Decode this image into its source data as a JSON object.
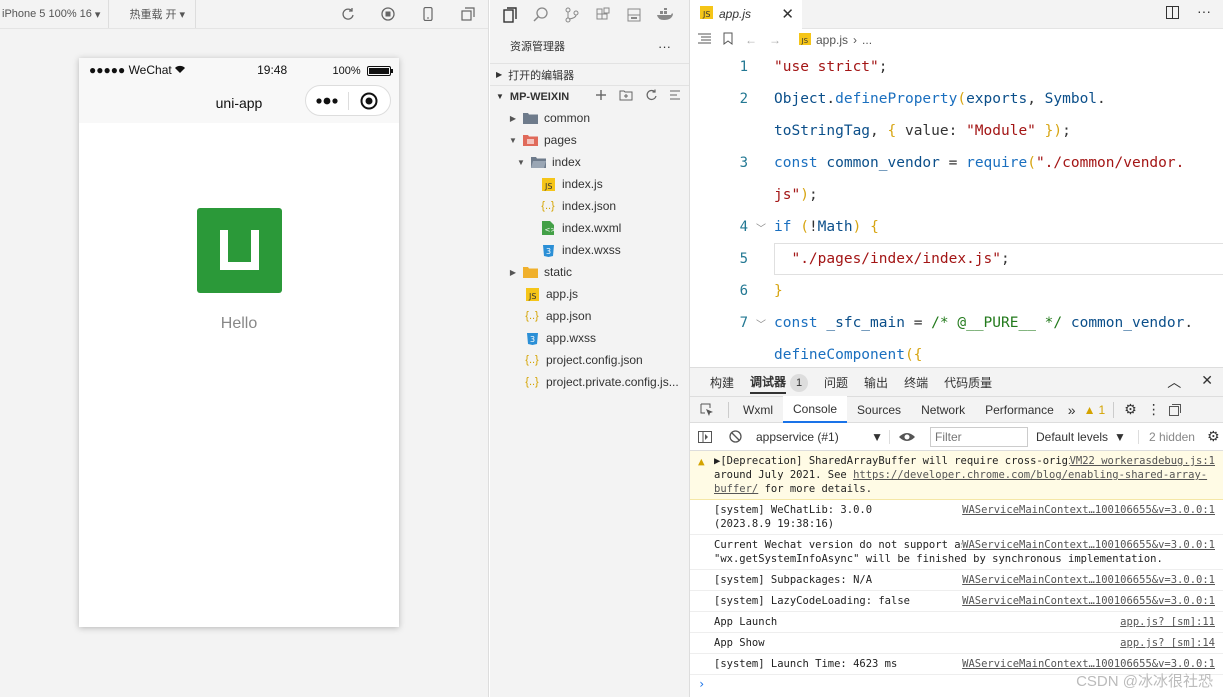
{
  "simulator": {
    "device_label": "iPhone 5 100% 16",
    "hot_reload_label": "热重载 开",
    "status": {
      "carrier": "●●●●● WeChat",
      "time": "19:48",
      "battery": "100%"
    },
    "nav_title": "uni-app",
    "hello": "Hello"
  },
  "explorer": {
    "title": "资源管理器",
    "more": "···",
    "open_editors": "打开的编辑器",
    "project": "MP-WEIXIN",
    "tree": [
      {
        "label": "common",
        "type": "folder"
      },
      {
        "label": "pages",
        "type": "folder-open"
      },
      {
        "label": "index",
        "type": "folder-open"
      },
      {
        "label": "index.js",
        "type": "js"
      },
      {
        "label": "index.json",
        "type": "json"
      },
      {
        "label": "index.wxml",
        "type": "wxml"
      },
      {
        "label": "index.wxss",
        "type": "wxss"
      },
      {
        "label": "static",
        "type": "folder"
      },
      {
        "label": "app.js",
        "type": "js"
      },
      {
        "label": "app.json",
        "type": "json"
      },
      {
        "label": "app.wxss",
        "type": "wxss"
      },
      {
        "label": "project.config.json",
        "type": "json"
      },
      {
        "label": "project.private.config.js...",
        "type": "json"
      }
    ]
  },
  "editor": {
    "tab_label": "app.js",
    "breadcrumb": {
      "file": "app.js",
      "more": "..."
    },
    "line_numbers": [
      "1",
      "2",
      "3",
      "4",
      "5",
      "6",
      "7"
    ]
  },
  "panel": {
    "tabs": [
      "构建",
      "调试器",
      "问题",
      "输出",
      "终端",
      "代码质量"
    ],
    "debugger_badge": "1",
    "devtools_tabs": [
      "Wxml",
      "Console",
      "Sources",
      "Network",
      "Performance"
    ],
    "more_tabs": "»",
    "warning_count": "1",
    "context": "appservice (#1)",
    "filter_placeholder": "Filter",
    "levels": "Default levels",
    "hidden": "2 hidden",
    "messages": [
      {
        "text": "▶[Deprecation] SharedArrayBuffer will require cross-origin isolation as of M92, around July 2021. See ",
        "link": "https://developer.chrome.com/blog/enabling-shared-array-buffer/",
        "tail": " for more details.",
        "source": "VM22 workerasdebug.js:1",
        "warn": true
      },
      {
        "text": "[system] WeChatLib: 3.0.0 (2023.8.9 19:38:16)",
        "source": "WAServiceMainContext…100106655&v=3.0.0:1"
      },
      {
        "text": "Current Wechat version do not support asynchronous getSystemInfo. \"wx.getSystemInfoAsync\" will be finished by synchronous implementation.",
        "source": "WAServiceMainContext…100106655&v=3.0.0:1"
      },
      {
        "text": "[system] Subpackages: N/A",
        "source": "WAServiceMainContext…100106655&v=3.0.0:1"
      },
      {
        "text": "[system] LazyCodeLoading: false",
        "source": "WAServiceMainContext…100106655&v=3.0.0:1"
      },
      {
        "text": "App Launch",
        "source": "app.js? [sm]:11"
      },
      {
        "text": "App Show",
        "source": "app.js? [sm]:14"
      },
      {
        "text": "[system] Launch Time: 4623 ms",
        "source": "WAServiceMainContext…100106655&v=3.0.0:1"
      }
    ],
    "prompt": "›"
  },
  "watermark": "CSDN @冰冰很社恐",
  "colors": {
    "logo": "#2b9939",
    "link_blue": "#1a73e8",
    "warning": "#d4a300"
  }
}
